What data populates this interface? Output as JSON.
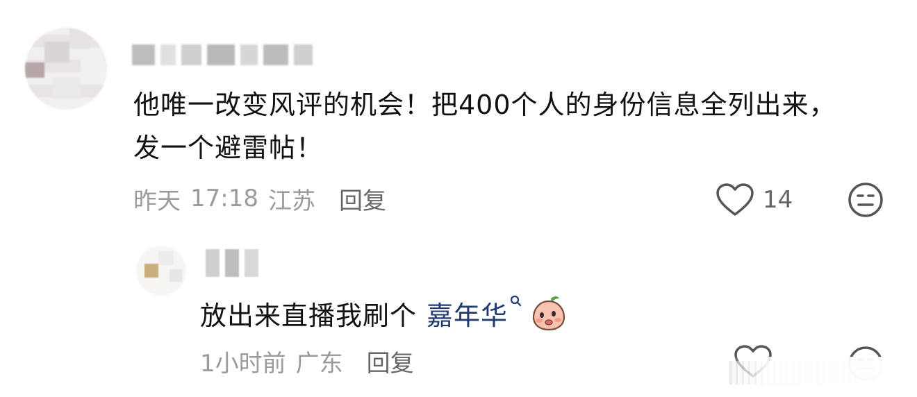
{
  "comment": {
    "text": "他唯一改变风评的机会！把400个人的身份信息全列出来，发一个避雷帖！",
    "date": "昨天",
    "time": "17:18",
    "location": "江苏",
    "reply_label": "回复",
    "like_count": "14",
    "icons": [
      "heart-icon",
      "dislike-face-icon"
    ]
  },
  "reply": {
    "text": "放出来直播我刷个",
    "link_text": "嘉年华",
    "time": "1小时前",
    "location": "广东",
    "reply_label": "回复",
    "icons": [
      "search-icon",
      "emoji-peach-icon",
      "heart-icon",
      "dislike-face-icon"
    ]
  },
  "colors": {
    "text": "#111111",
    "meta": "#9b9b9b",
    "link": "#1e3a70",
    "icon": "#555555"
  }
}
